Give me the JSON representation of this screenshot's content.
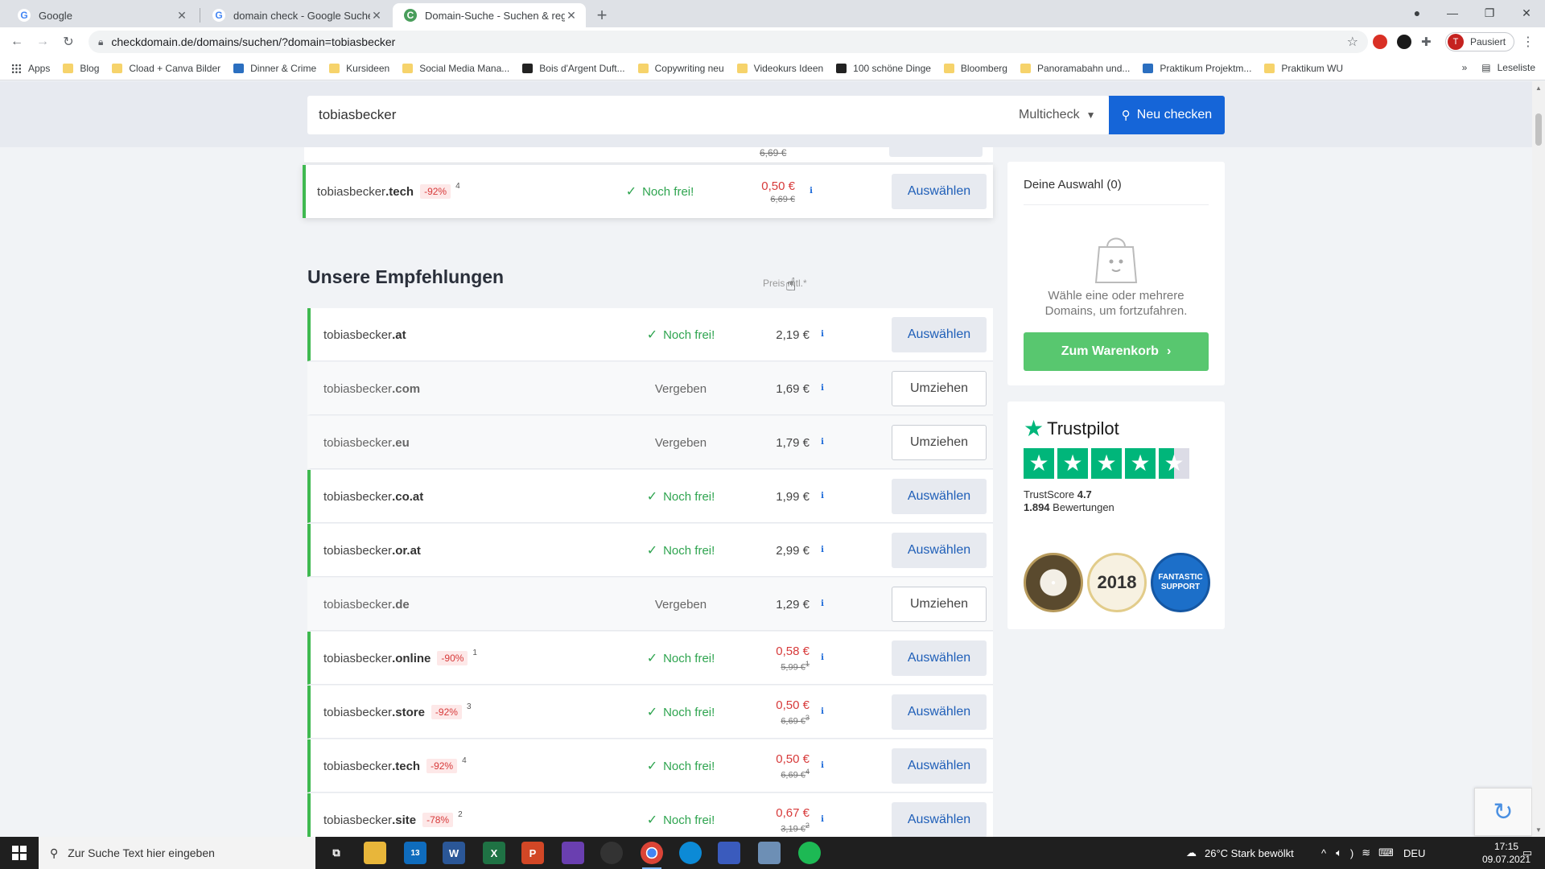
{
  "browser": {
    "tabs": [
      {
        "title": "Google",
        "favicon": "G",
        "active": false
      },
      {
        "title": "domain check - Google Suche",
        "favicon": "G",
        "active": false
      },
      {
        "title": "Domain-Suche - Suchen & regist",
        "favicon": "C",
        "active": true
      }
    ],
    "url": "checkdomain.de/domains/suchen/?domain=tobiasbecker",
    "profile_label": "Pausiert",
    "profile_initial": "T",
    "bookmarks": [
      {
        "label": "Apps",
        "icon": "grid"
      },
      {
        "label": "Blog",
        "icon": "folder"
      },
      {
        "label": "Cload + Canva Bilder",
        "icon": "folder"
      },
      {
        "label": "Dinner & Crime",
        "icon": "blue"
      },
      {
        "label": "Kursideen",
        "icon": "folder"
      },
      {
        "label": "Social Media Mana...",
        "icon": "folder"
      },
      {
        "label": "Bois d'Argent Duft...",
        "icon": "dark"
      },
      {
        "label": "Copywriting neu",
        "icon": "folder"
      },
      {
        "label": "Videokurs Ideen",
        "icon": "folder"
      },
      {
        "label": "100 schöne Dinge",
        "icon": "dark"
      },
      {
        "label": "Bloomberg",
        "icon": "folder"
      },
      {
        "label": "Panoramabahn und...",
        "icon": "folder"
      },
      {
        "label": "Praktikum Projektm...",
        "icon": "blue"
      },
      {
        "label": "Praktikum WU",
        "icon": "folder"
      }
    ],
    "bookmarks_more": "»",
    "reading_list": "Leseliste"
  },
  "search": {
    "value": "tobiasbecker",
    "mode": "Multicheck",
    "button": "Neu checken"
  },
  "highlighted": {
    "name": "tobiasbecker",
    "tld": ".tech",
    "discount": "-92%",
    "sup": "4",
    "status": "Noch frei!",
    "price": "0,50 €",
    "old_price": "6,69 €",
    "action": "Auswählen",
    "partial_old_price": "6,69 €"
  },
  "recommendations": {
    "title": "Unsere Empfehlungen",
    "price_header": "Preis mtl.*",
    "info_label": "i",
    "rows": [
      {
        "name": "tobiasbecker",
        "tld": ".at",
        "free": true,
        "status": "Noch frei!",
        "price": "2,19 €",
        "action": "Auswählen"
      },
      {
        "name": "tobiasbecker",
        "tld": ".com",
        "free": false,
        "status": "Vergeben",
        "price": "1,69 €",
        "action": "Umziehen"
      },
      {
        "name": "tobiasbecker",
        "tld": ".eu",
        "free": false,
        "status": "Vergeben",
        "price": "1,79 €",
        "action": "Umziehen"
      },
      {
        "name": "tobiasbecker",
        "tld": ".co.at",
        "free": true,
        "status": "Noch frei!",
        "price": "1,99 €",
        "action": "Auswählen"
      },
      {
        "name": "tobiasbecker",
        "tld": ".or.at",
        "free": true,
        "status": "Noch frei!",
        "price": "2,99 €",
        "action": "Auswählen"
      },
      {
        "name": "tobiasbecker",
        "tld": ".de",
        "free": false,
        "status": "Vergeben",
        "price": "1,29 €",
        "action": "Umziehen"
      },
      {
        "name": "tobiasbecker",
        "tld": ".online",
        "free": true,
        "discount": "-90%",
        "sup": "1",
        "status": "Noch frei!",
        "price": "0,58 €",
        "old_price": "5,99 €",
        "old_sup": "1",
        "action": "Auswählen"
      },
      {
        "name": "tobiasbecker",
        "tld": ".store",
        "free": true,
        "discount": "-92%",
        "sup": "3",
        "status": "Noch frei!",
        "price": "0,50 €",
        "old_price": "6,69 €",
        "old_sup": "3",
        "action": "Auswählen"
      },
      {
        "name": "tobiasbecker",
        "tld": ".tech",
        "free": true,
        "discount": "-92%",
        "sup": "4",
        "status": "Noch frei!",
        "price": "0,50 €",
        "old_price": "6,69 €",
        "old_sup": "4",
        "action": "Auswählen"
      },
      {
        "name": "tobiasbecker",
        "tld": ".site",
        "free": true,
        "discount": "-78%",
        "sup": "2",
        "status": "Noch frei!",
        "price": "0,67 €",
        "old_price": "3,19 €",
        "old_sup": "2",
        "action": "Auswählen"
      }
    ]
  },
  "cart": {
    "title": "Deine Auswahl (0)",
    "empty_text": "Wähle eine oder mehrere Domains, um fortzufahren.",
    "button": "Zum Warenkorb"
  },
  "trustpilot": {
    "brand": "Trustpilot",
    "score_label": "TrustScore",
    "score": "4.7",
    "reviews_count": "1.894",
    "reviews_label": "Bewertungen",
    "rating": 4.5,
    "seal_2": "2018",
    "seal_3": "FANTASTIC SUPPORT"
  },
  "taskbar": {
    "search_placeholder": "Zur Suche Text hier eingeben",
    "weather": "26°C  Stark bewölkt",
    "language": "DEU",
    "time": "17:15",
    "date": "09.07.2021",
    "mail_badge": "13"
  },
  "colors": {
    "accent_blue": "#1565d8",
    "free_green": "#3fb950",
    "cart_green": "#58c76f",
    "discount_red": "#d73a3a",
    "trustpilot_green": "#00b67a"
  }
}
